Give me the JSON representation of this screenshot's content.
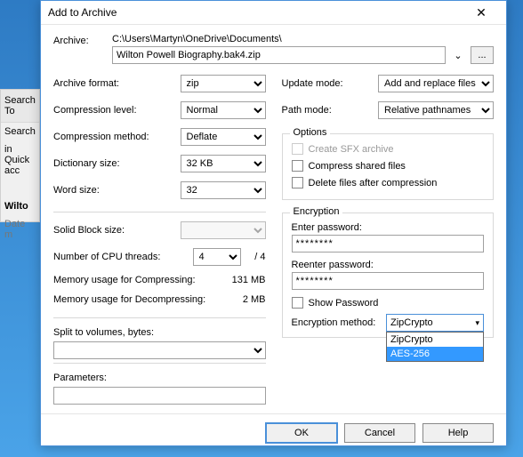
{
  "bg": {
    "searchTab": "Search To",
    "searchBtn": "Search",
    "quick": "in Quick acc",
    "file": "Wilto",
    "date": "Date m"
  },
  "title": "Add to Archive",
  "archive": {
    "label": "Archive:",
    "path": "C:\\Users\\Martyn\\OneDrive\\Documents\\",
    "name": "Wilton Powell Biography.bak4.zip",
    "browse": "..."
  },
  "left": {
    "formatLabel": "Archive format:",
    "format": "zip",
    "compLevelLabel": "Compression level:",
    "compLevel": "Normal",
    "compMethodLabel": "Compression method:",
    "compMethod": "Deflate",
    "dictLabel": "Dictionary size:",
    "dict": "32 KB",
    "wordLabel": "Word size:",
    "word": "32",
    "solidLabel": "Solid Block size:",
    "solid": "",
    "threadsLabel": "Number of CPU threads:",
    "threads": "4",
    "threadsMax": "/ 4",
    "memCompLabel": "Memory usage for Compressing:",
    "memComp": "131 MB",
    "memDecompLabel": "Memory usage for Decompressing:",
    "memDecomp": "2 MB",
    "splitLabel": "Split to volumes, bytes:",
    "paramsLabel": "Parameters:"
  },
  "right": {
    "updateLabel": "Update mode:",
    "update": "Add and replace files",
    "pathLabel": "Path mode:",
    "path": "Relative pathnames",
    "optionsTitle": "Options",
    "sfx": "Create SFX archive",
    "shared": "Compress shared files",
    "deleteAfter": "Delete files after compression",
    "encTitle": "Encryption",
    "enterPwd": "Enter password:",
    "reenterPwd": "Reenter password:",
    "pwdMask": "********",
    "showPwd": "Show Password",
    "encMethodLabel": "Encryption method:",
    "encSelected": "ZipCrypto",
    "encOpt1": "ZipCrypto",
    "encOpt2": "AES-256"
  },
  "buttons": {
    "ok": "OK",
    "cancel": "Cancel",
    "help": "Help"
  }
}
